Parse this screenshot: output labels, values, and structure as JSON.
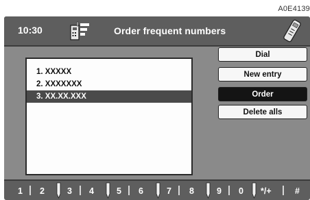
{
  "figure_code": "A0E4139",
  "status_bar": {
    "time": "10:30",
    "title": "Order frequent numbers"
  },
  "list": {
    "items": [
      {
        "label": "1. XXXXX"
      },
      {
        "label": "2. XXXXXXX"
      },
      {
        "label": "3. XX.XX.XXX",
        "selected": true
      }
    ]
  },
  "menu": {
    "dial": "Dial",
    "new_entry": "New entry",
    "order": "Order",
    "delete_all": "Delete alls",
    "active": "order"
  },
  "keypad": [
    "1",
    "2",
    "3",
    "4",
    "5",
    "6",
    "7",
    "8",
    "9",
    "0",
    "*/+",
    "#"
  ],
  "icons": {
    "left": "phonebook-icon",
    "right": "phone-handset-icon",
    "key_marker": "key-marker-icon"
  },
  "colors": {
    "screen": "#8a8a8a",
    "bars": "#5e5e5e",
    "selection": "#4a4a4a",
    "active_button": "#141414"
  }
}
